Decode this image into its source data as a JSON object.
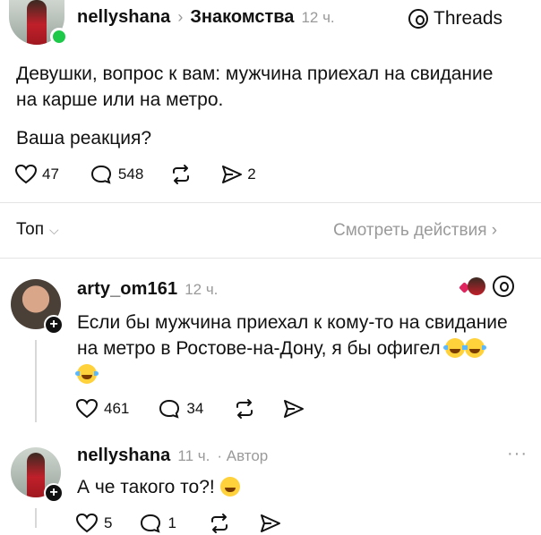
{
  "post": {
    "username": "nellyshana",
    "separator": "›",
    "section": "Знакомства",
    "time": "12 ч.",
    "badge": "Threads",
    "text_line1": "Девушки, вопрос к вам: мужчина приехал на свидание",
    "text_line2": "на карше или на метро.",
    "text_line3": "Ваша реакция?",
    "likes": "47",
    "comments": "548",
    "shares": "2"
  },
  "sort": {
    "label": "Топ",
    "chevron": "⌵",
    "activity_link": "Смотреть действия ›"
  },
  "reply1": {
    "username": "arty_om161",
    "time": "12 ч.",
    "text_line1": "Если бы мужчина приехал к кому-то на свидание",
    "text_line2": "на метро в Ростове-на-Дону, я бы офигел",
    "likes": "461",
    "comments": "34"
  },
  "reply2": {
    "username": "nellyshana",
    "time": "11 ч.",
    "author_label": "· Автор",
    "more": "···",
    "text": "А че такого то?!",
    "likes": "5",
    "comments": "1"
  },
  "icons": {
    "plus": "+",
    "heart": "heart-icon",
    "comment": "comment-icon",
    "repost": "repost-icon",
    "share": "share-icon"
  }
}
